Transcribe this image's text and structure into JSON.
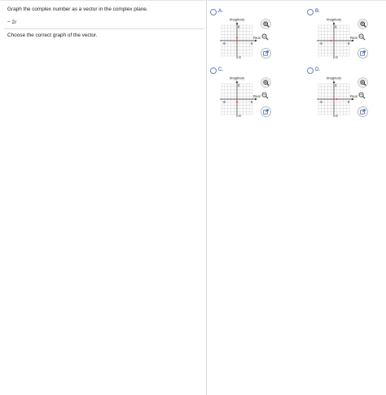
{
  "question": {
    "instruction": "Graph the complex number as a vector in the complex plane.",
    "number_prefix": "− 2",
    "number_unit": "i",
    "prompt": "Choose the correct graph of the vector."
  },
  "graph_labels": {
    "vertical_axis": "Imaginary",
    "horizontal_axis": "Real",
    "tick_neg": "-8",
    "tick_pos": "8",
    "top_tick": "8",
    "bottom_tick": "-8"
  },
  "options": [
    {
      "letter": "A.",
      "vector": {
        "real": 0,
        "imag": 2
      }
    },
    {
      "letter": "B.",
      "vector": {
        "real": -2,
        "imag": 0
      }
    },
    {
      "letter": "C.",
      "vector": {
        "real": 0,
        "imag": -2
      }
    },
    {
      "letter": "D.",
      "vector": {
        "real": 2,
        "imag": 0
      }
    }
  ],
  "colors": {
    "vector": "#d9302c",
    "grid": "#c8c8c8",
    "axis": "#333333",
    "accent": "#1a4fa0"
  },
  "icons": {
    "zoom_in": "zoom-in-icon",
    "zoom_out": "zoom-out-icon",
    "external": "open-external-icon"
  }
}
